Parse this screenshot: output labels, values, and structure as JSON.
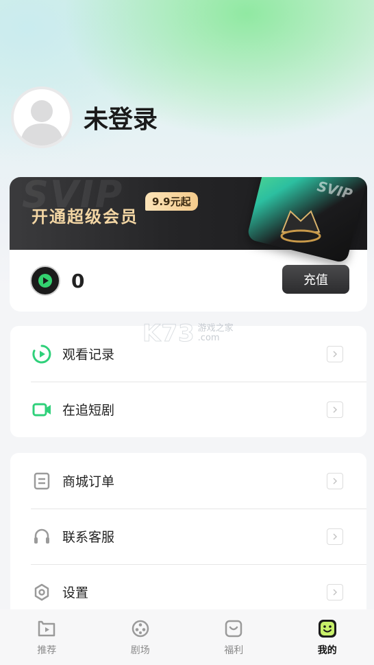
{
  "profile": {
    "username": "未登录"
  },
  "vip": {
    "watermark": "SVIP",
    "title": "开通超级会员",
    "price_badge": "9.9元起",
    "card_text": "SVIP"
  },
  "wallet": {
    "coin_value": "0",
    "recharge_label": "充值"
  },
  "menu_group_1": [
    {
      "label": "观看记录",
      "icon": "play-circle-icon"
    },
    {
      "label": "在追短剧",
      "icon": "video-camera-icon"
    }
  ],
  "menu_group_2": [
    {
      "label": "商城订单",
      "icon": "order-icon"
    },
    {
      "label": "联系客服",
      "icon": "headset-icon"
    },
    {
      "label": "设置",
      "icon": "settings-icon"
    }
  ],
  "watermark": {
    "brand": "K73",
    "line1": "游戏之家",
    "line2": ".com"
  },
  "tabs": [
    {
      "label": "推荐",
      "icon": "tv-play-icon",
      "active": false
    },
    {
      "label": "剧场",
      "icon": "film-reel-icon",
      "active": false
    },
    {
      "label": "福利",
      "icon": "gift-smile-icon",
      "active": false
    },
    {
      "label": "我的",
      "icon": "smiley-face-icon",
      "active": true
    }
  ],
  "colors": {
    "accent_green": "#2fd07a",
    "dark": "#2c2c2e",
    "gold": "#f3d6a4"
  }
}
